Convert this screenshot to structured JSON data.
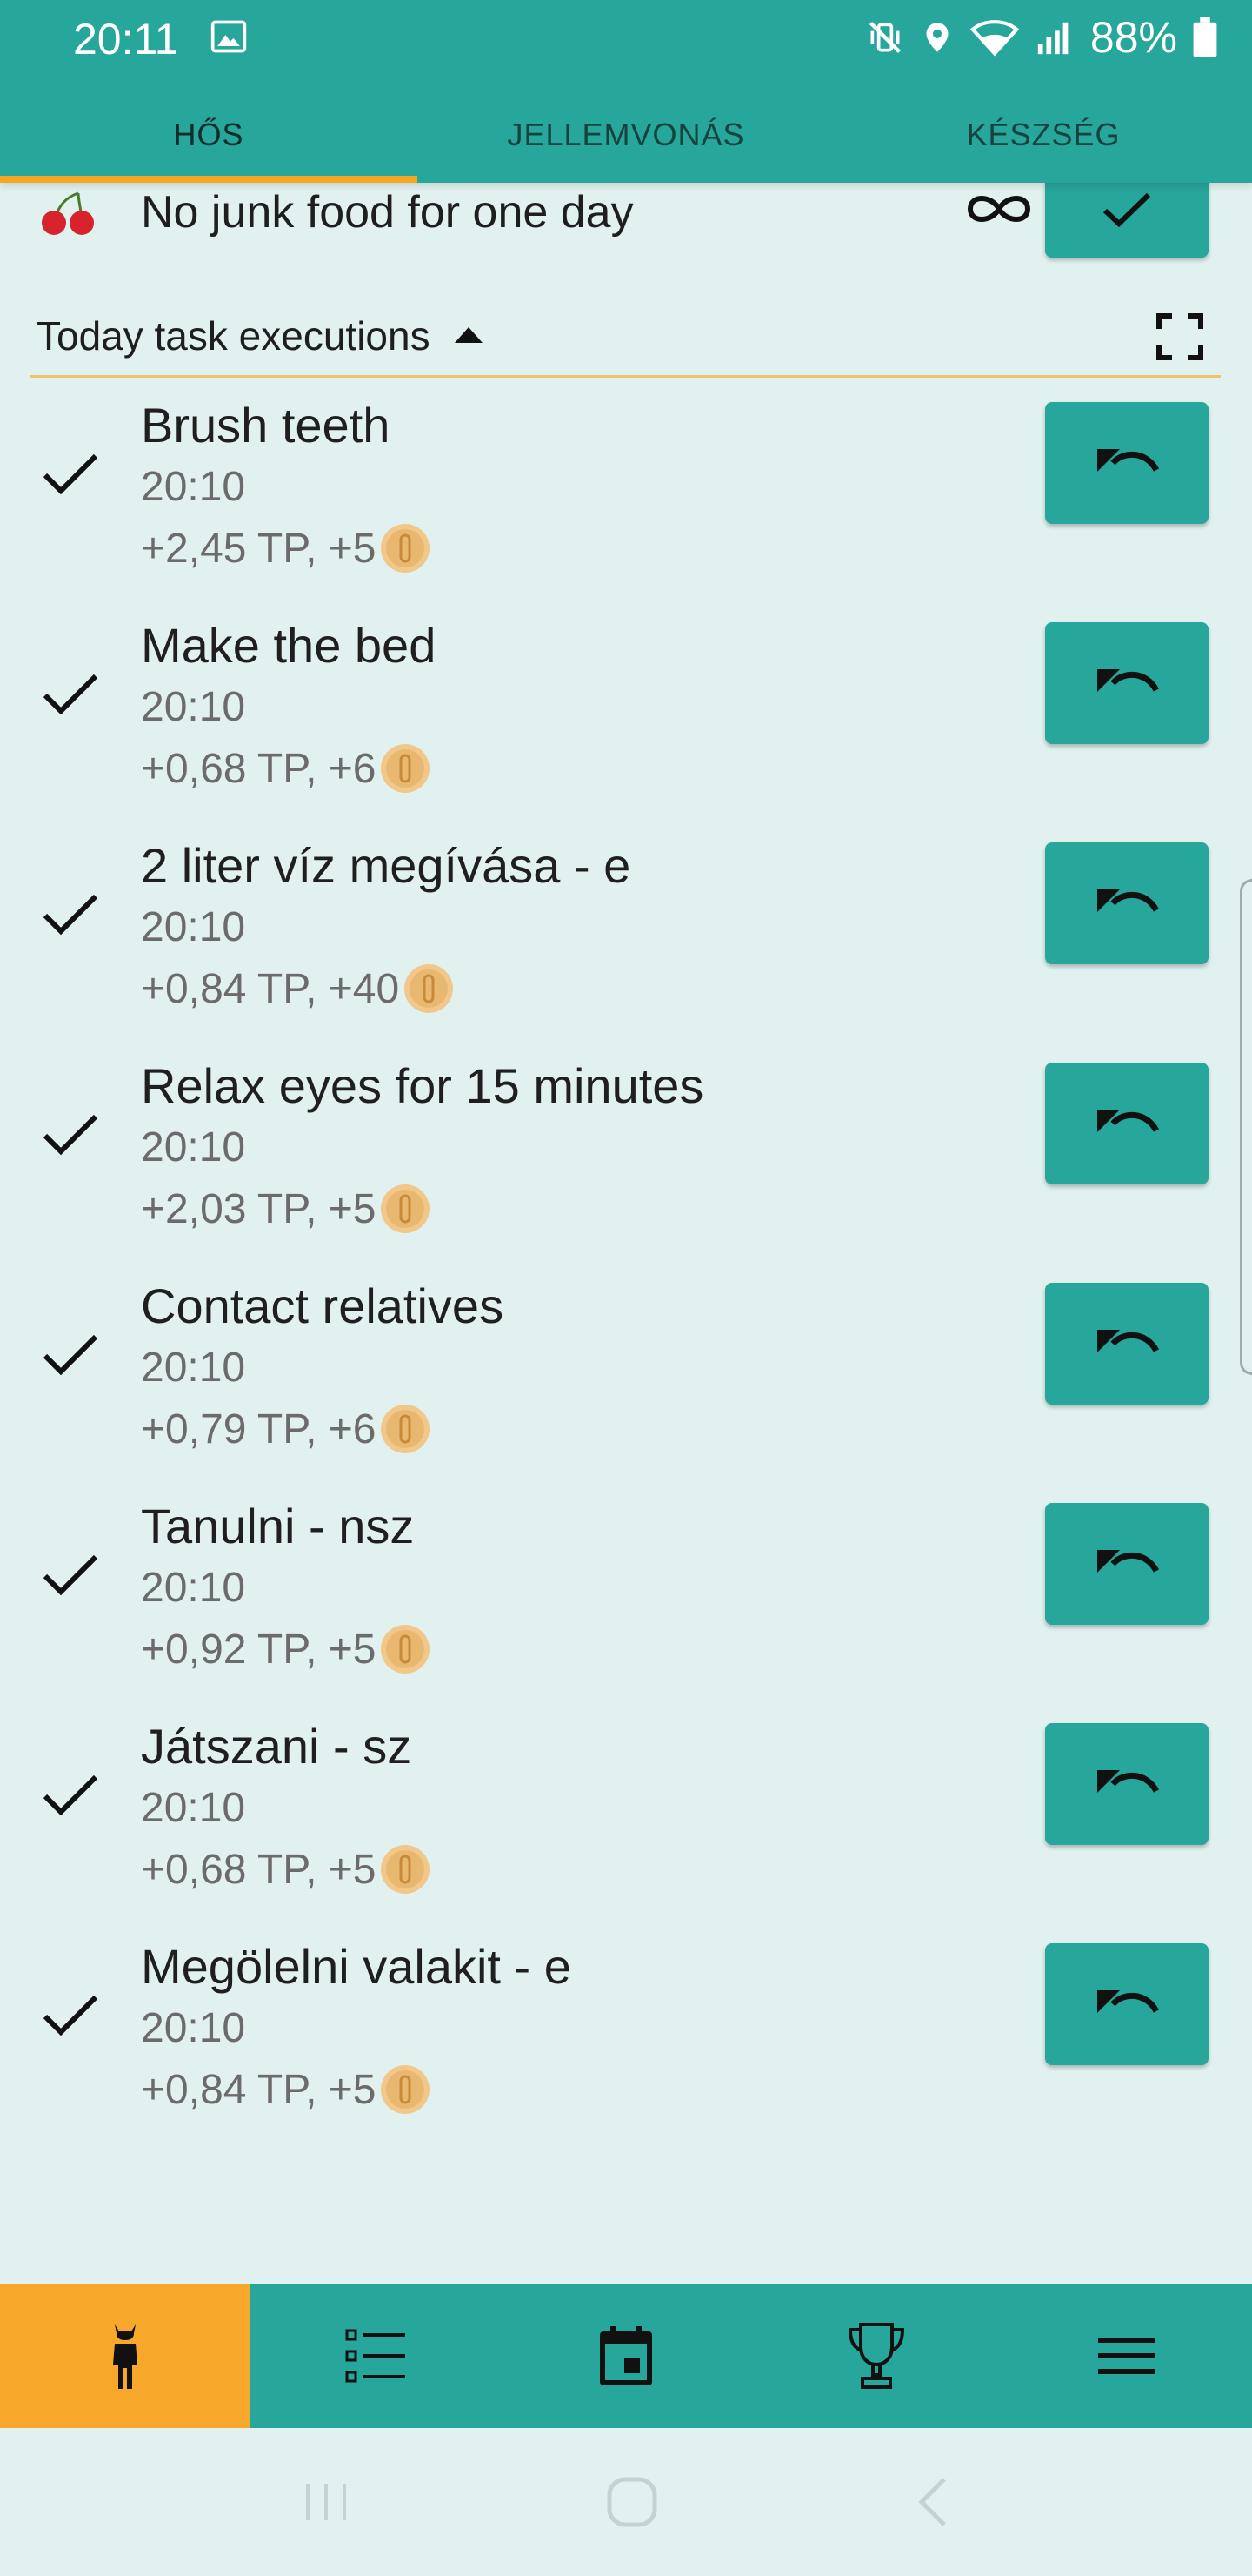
{
  "status_bar": {
    "time": "20:11",
    "battery": "88%",
    "icons": [
      "image-icon",
      "mute-vibrate-icon",
      "location-icon",
      "wifi-icon",
      "signal-icon",
      "battery-icon"
    ]
  },
  "tabs": [
    {
      "label": "HŐS",
      "active": true
    },
    {
      "label": "JELLEMVONÁS",
      "active": false
    },
    {
      "label": "KÉSZSÉG",
      "active": false
    }
  ],
  "partial_task": {
    "title": "No junk food for one day",
    "icon": "cherry-icon",
    "repeat_icon": "infinity-icon",
    "button_icon": "check-icon"
  },
  "section": {
    "title": "Today task executions",
    "collapse_icon": "triangle-up-icon",
    "expand_icon": "fullscreen-icon"
  },
  "tasks": [
    {
      "name": "Brush teeth",
      "time": "20:10",
      "reward": "+2,45 TP, +5"
    },
    {
      "name": "Make the bed",
      "time": "20:10",
      "reward": "+0,68 TP, +6"
    },
    {
      "name": "2 liter víz megívása - e",
      "time": "20:10",
      "reward": "+0,84 TP, +40"
    },
    {
      "name": "Relax eyes for 15 minutes",
      "time": "20:10",
      "reward": "+2,03 TP, +5"
    },
    {
      "name": "Contact relatives",
      "time": "20:10",
      "reward": "+0,79 TP, +6"
    },
    {
      "name": "Tanulni - nsz",
      "time": "20:10",
      "reward": "+0,92 TP, +5"
    },
    {
      "name": "Játszani - sz",
      "time": "20:10",
      "reward": "+0,68 TP, +5"
    },
    {
      "name": "Megölelni valakit - e",
      "time": "20:10",
      "reward": "+0,84 TP, +5"
    }
  ],
  "bottom_nav": [
    {
      "icon": "hero-icon",
      "active": true
    },
    {
      "icon": "task-list-icon",
      "active": false
    },
    {
      "icon": "calendar-icon",
      "active": false
    },
    {
      "icon": "trophy-icon",
      "active": false
    },
    {
      "icon": "menu-icon",
      "active": false
    }
  ],
  "colors": {
    "primary": "#27a69b",
    "accent": "#f7a72a",
    "background": "#e1f1ef",
    "divider": "#f0c36a"
  }
}
